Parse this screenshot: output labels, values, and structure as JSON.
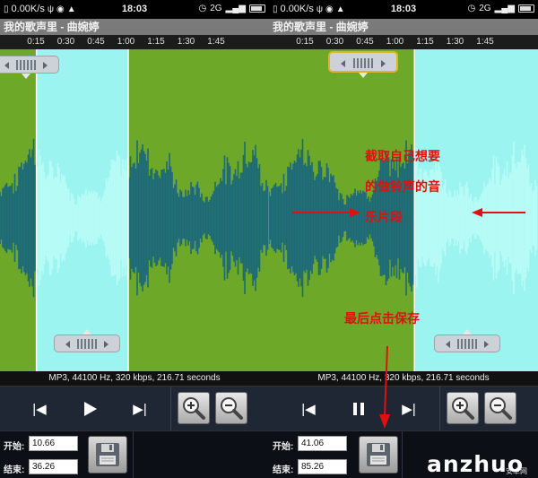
{
  "status_bar": {
    "speed": "0.00K/s",
    "usb": "ψ",
    "time": "18:03",
    "sim": "2G"
  },
  "song_title": "我的歌声里 - 曲婉婷",
  "time_ticks": [
    "0:15",
    "0:30",
    "0:45",
    "1:00",
    "1:15",
    "1:30",
    "1:45"
  ],
  "file_info": "MP3, 44100 Hz, 320 kbps, 216.71 seconds",
  "start_label": "开始:",
  "end_label": "结束:",
  "duration_seconds": 216.71,
  "panels": [
    {
      "start_value": "10.66",
      "end_value": "36.26",
      "playing": false,
      "start_handle_active": false,
      "end_handle_active": true
    },
    {
      "start_value": "41.06",
      "end_value": "85.26",
      "playing": true,
      "start_handle_active": true,
      "end_handle_active": false
    }
  ],
  "annotations": {
    "select_segment": [
      "截取自己想要",
      "的做铃声的音",
      "乐片段"
    ],
    "save_hint": "最后点击保存"
  },
  "watermark": {
    "logo": "anzhuo",
    "site": "安卓网"
  },
  "colors": {
    "wave_green": "#6ea828",
    "wave_bg": "#1c6a78",
    "selection": "#9cf4f0",
    "annotation_red": "#e01010"
  }
}
